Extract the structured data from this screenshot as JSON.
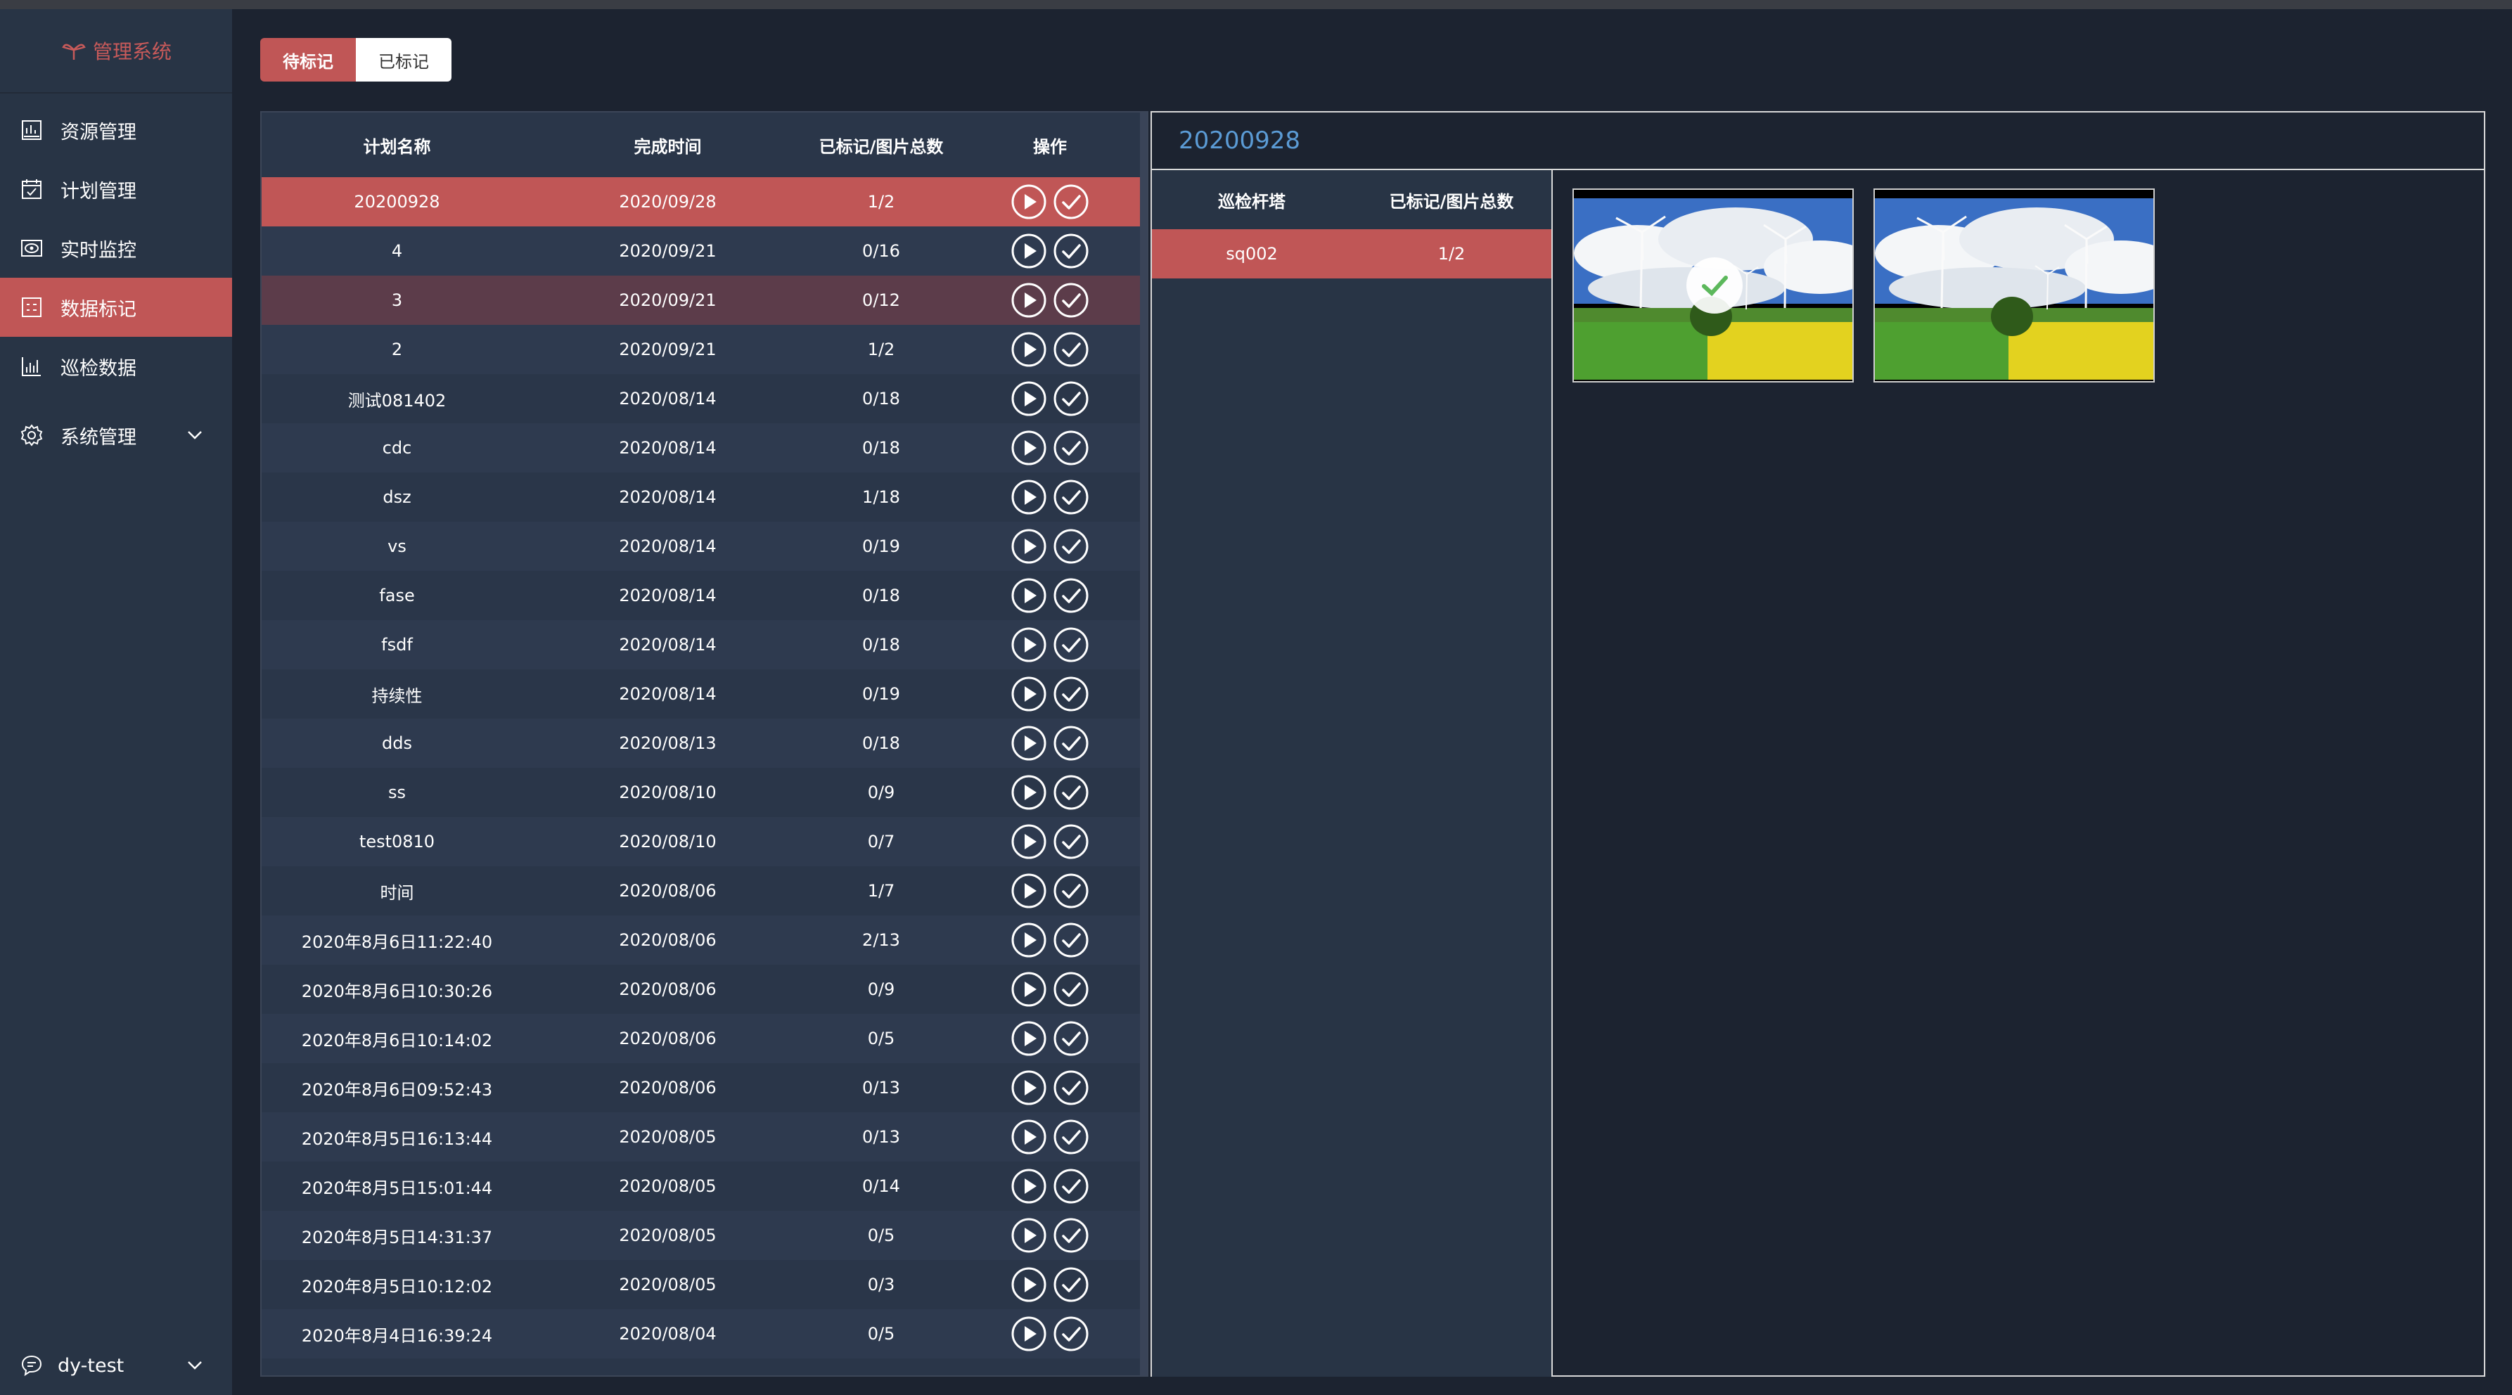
{
  "app": {
    "title": "管理系统",
    "accent_color": "#c05656",
    "title_color": "#5b9bd5"
  },
  "sidebar": {
    "items": [
      {
        "label": "资源管理",
        "icon": "resource-icon"
      },
      {
        "label": "计划管理",
        "icon": "calendar-icon"
      },
      {
        "label": "实时监控",
        "icon": "monitor-icon"
      },
      {
        "label": "数据标记",
        "icon": "mark-icon",
        "active": true
      },
      {
        "label": "巡检数据",
        "icon": "chart-icon"
      },
      {
        "label": "系统管理",
        "icon": "gear-icon"
      }
    ],
    "user": "dy-test"
  },
  "tabs": [
    {
      "label": "待标记",
      "active": true
    },
    {
      "label": "已标记",
      "active": false
    }
  ],
  "plan_table": {
    "headers": [
      "计划名称",
      "完成时间",
      "已标记/图片总数",
      "操作"
    ],
    "rows": [
      {
        "name": "20200928",
        "time": "2020/09/28",
        "count": "1/2"
      },
      {
        "name": "4",
        "time": "2020/09/21",
        "count": "0/16"
      },
      {
        "name": "3",
        "time": "2020/09/21",
        "count": "0/12"
      },
      {
        "name": "2",
        "time": "2020/09/21",
        "count": "1/2"
      },
      {
        "name": "测试081402",
        "time": "2020/08/14",
        "count": "0/18"
      },
      {
        "name": "cdc",
        "time": "2020/08/14",
        "count": "0/18"
      },
      {
        "name": "dsz",
        "time": "2020/08/14",
        "count": "1/18"
      },
      {
        "name": "vs",
        "time": "2020/08/14",
        "count": "0/19"
      },
      {
        "name": "fase",
        "time": "2020/08/14",
        "count": "0/18"
      },
      {
        "name": "fsdf",
        "time": "2020/08/14",
        "count": "0/18"
      },
      {
        "name": "持续性",
        "time": "2020/08/14",
        "count": "0/19"
      },
      {
        "name": "dds",
        "time": "2020/08/13",
        "count": "0/18"
      },
      {
        "name": "ss",
        "time": "2020/08/10",
        "count": "0/9"
      },
      {
        "name": "test0810",
        "time": "2020/08/10",
        "count": "0/7"
      },
      {
        "name": "时间",
        "time": "2020/08/06",
        "count": "1/7"
      },
      {
        "name": "2020年8月6日11:22:40",
        "time": "2020/08/06",
        "count": "2/13"
      },
      {
        "name": "2020年8月6日10:30:26",
        "time": "2020/08/06",
        "count": "0/9"
      },
      {
        "name": "2020年8月6日10:14:02",
        "time": "2020/08/06",
        "count": "0/5"
      },
      {
        "name": "2020年8月6日09:52:43",
        "time": "2020/08/06",
        "count": "0/13"
      },
      {
        "name": "2020年8月5日16:13:44",
        "time": "2020/08/05",
        "count": "0/13"
      },
      {
        "name": "2020年8月5日15:01:44",
        "time": "2020/08/05",
        "count": "0/14"
      },
      {
        "name": "2020年8月5日14:31:37",
        "time": "2020/08/05",
        "count": "0/5"
      },
      {
        "name": "2020年8月5日10:12:02",
        "time": "2020/08/05",
        "count": "0/3"
      },
      {
        "name": "2020年8月4日16:39:24",
        "time": "2020/08/04",
        "count": "0/5"
      }
    ]
  },
  "detail": {
    "title": "20200928",
    "tower_headers": [
      "巡检杆塔",
      "已标记/图片总数"
    ],
    "towers": [
      {
        "name": "sq002",
        "count": "1/2"
      }
    ],
    "images": [
      {
        "alt": "wind-turbine-photo",
        "marked": true
      },
      {
        "alt": "wind-turbine-photo",
        "marked": false
      }
    ]
  }
}
